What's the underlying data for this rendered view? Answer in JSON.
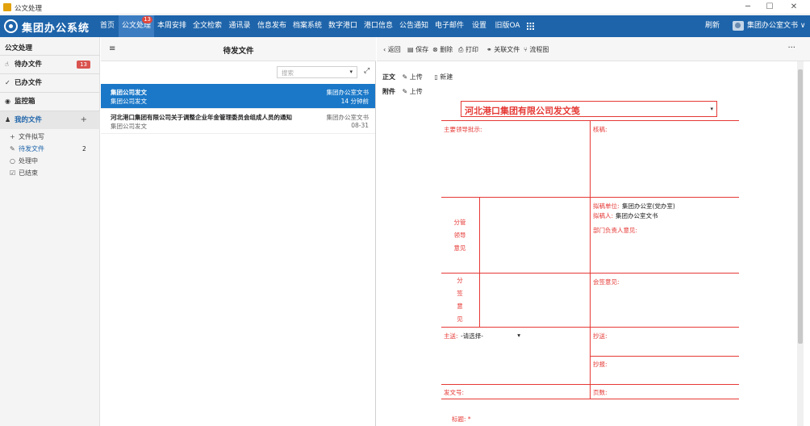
{
  "window": {
    "title": "公文处理",
    "minimize_icon": "─",
    "maximize_icon": "☐",
    "close_icon": "✕"
  },
  "topnav": {
    "brand": "集团办公系统",
    "items": [
      {
        "label": "首页"
      },
      {
        "label": "公文处理",
        "badge": "13"
      },
      {
        "label": "本周安排"
      },
      {
        "label": "全文检索"
      },
      {
        "label": "通讯录"
      },
      {
        "label": "信息发布"
      },
      {
        "label": "档案系统"
      },
      {
        "label": "数字港口"
      },
      {
        "label": "港口信息"
      },
      {
        "label": "公告通知"
      },
      {
        "label": "电子邮件"
      },
      {
        "label": "设置"
      },
      {
        "label": "旧版OA"
      }
    ],
    "grid_icon": "grid-icon",
    "refresh": "刷新",
    "user": "集团办公室文书",
    "user_caret": "∨",
    "accent": "#1e64aa"
  },
  "sidebar": {
    "title": "公文处理",
    "items": [
      {
        "label": "待办文件",
        "icon": "hand-icon",
        "badge": "13"
      },
      {
        "label": "已办文件",
        "icon": "check-icon"
      },
      {
        "label": "监控箱",
        "icon": "eye-icon"
      },
      {
        "label": "我的文件",
        "icon": "user-icon",
        "plus": "+"
      }
    ],
    "sub": [
      {
        "label": "文件拟写",
        "icon": "plus-icon"
      },
      {
        "label": "待发文件",
        "icon": "edit-icon",
        "count": "2"
      },
      {
        "label": "处理中",
        "icon": "clock-icon"
      },
      {
        "label": "已结束",
        "icon": "checkbox-icon"
      }
    ]
  },
  "list": {
    "title": "待发文件",
    "search_placeholder": "搜索",
    "rows": [
      {
        "title": "集团公司发文",
        "sub": "集团公司发文",
        "author": "集团办公室文书",
        "time": "14 分钟前"
      },
      {
        "title": "河北港口集团有限公司关于调整企业年金管理委员会组成人员的通知",
        "sub": "集团公司发文",
        "author": "集团办公室文书",
        "time": "08-31"
      }
    ]
  },
  "toolbar": {
    "back": "返回",
    "save": "保存",
    "delete": "删除",
    "print": "打印",
    "related": "关联文件",
    "flow": "流程图",
    "more": "···"
  },
  "attachments": {
    "body_label": "正文",
    "upload": "上传",
    "new": "新建",
    "att_label": "附件"
  },
  "form": {
    "title": "河北港口集团有限公司发文笺",
    "leader_instruction": "主要领导批示:",
    "approval": "核稿:",
    "draft_unit_label": "拟稿单位:",
    "draft_unit_value": "集团办公室(党办室)",
    "drafter_label": "拟稿人:",
    "drafter_value": "集团办公室文书",
    "dept_head": "部门负责人意见:",
    "branch_leader": [
      "分管",
      "领导",
      "意见"
    ],
    "countersign_label": [
      "分",
      "签",
      "意",
      "见"
    ],
    "countersign_opinion": "会签意见:",
    "main_send_label": "主送:",
    "main_send_value": "-请选择-",
    "cc": "抄送:",
    "report": "抄报:",
    "doc_no": "发文号:",
    "pages": "页数:",
    "subject_label": "标题:",
    "required_mark": "*",
    "line_color": "#e53935"
  }
}
